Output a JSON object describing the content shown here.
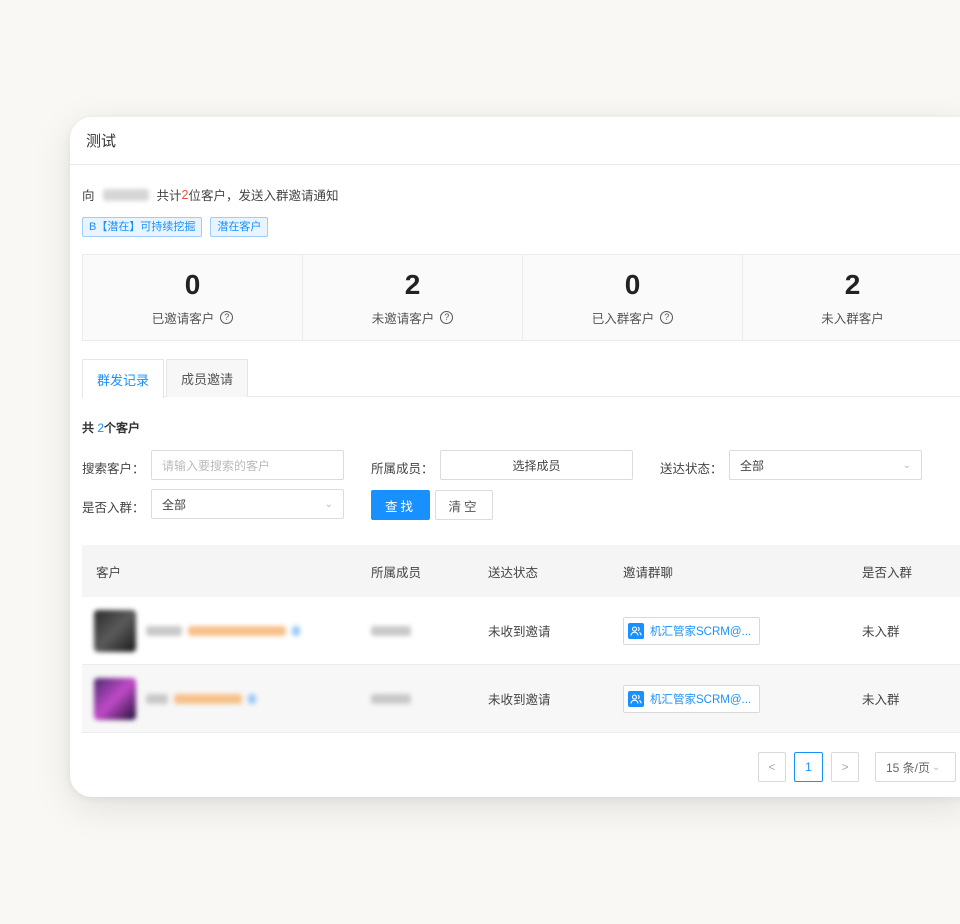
{
  "card": {
    "title": "测试"
  },
  "notice": {
    "prefix": "向",
    "text_before_count": "共计",
    "count": "2",
    "text_after_count": "位客户，发送入群邀请通知"
  },
  "tags": [
    "B【潜在】可持续挖掘",
    "潜在客户"
  ],
  "stats": [
    {
      "value": "0",
      "label": "已邀请客户"
    },
    {
      "value": "2",
      "label": "未邀请客户"
    },
    {
      "value": "0",
      "label": "已入群客户"
    },
    {
      "value": "2",
      "label": "未入群客户"
    }
  ],
  "tabs": [
    {
      "label": "群发记录",
      "active": true
    },
    {
      "label": "成员邀请",
      "active": false
    }
  ],
  "total": {
    "prefix": "共",
    "count": "2",
    "suffix": "个客户"
  },
  "filters": {
    "search_label": "搜索客户：",
    "search_placeholder": "请输入要搜索的客户",
    "member_label": "所属成员：",
    "member_button": "选择成员",
    "delivery_label": "送达状态：",
    "delivery_value": "全部",
    "joined_label": "是否入群：",
    "joined_value": "全部",
    "search_button": "查找",
    "clear_button": "清空"
  },
  "table": {
    "headers": [
      "客户",
      "所属成员",
      "送达状态",
      "邀请群聊",
      "是否入群"
    ],
    "rows": [
      {
        "delivery": "未收到邀请",
        "group": "机汇管家SCRM@...",
        "joined": "未入群"
      },
      {
        "delivery": "未收到邀请",
        "group": "机汇管家SCRM@...",
        "joined": "未入群"
      }
    ]
  },
  "pagination": {
    "prev": "<",
    "current": "1",
    "next": ">",
    "page_size": "15 条/页"
  },
  "icons": {
    "help": "question-circle-icon",
    "chevron": "chevron-down-icon",
    "group": "group-chat-icon",
    "link": "link-icon"
  },
  "colors": {
    "primary": "#1890ff",
    "highlight": "#f24e3d"
  }
}
